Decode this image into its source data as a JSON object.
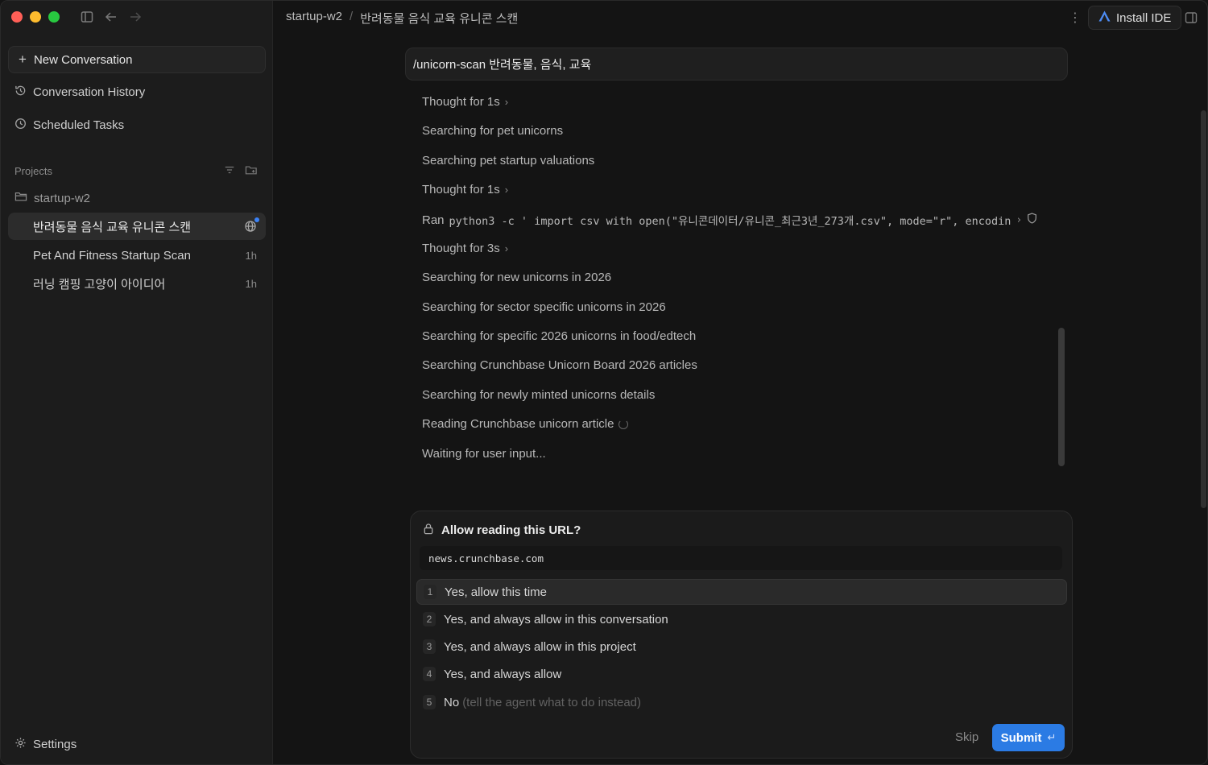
{
  "sidebar": {
    "new_conversation": "New Conversation",
    "conversation_history": "Conversation History",
    "scheduled_tasks": "Scheduled Tasks",
    "projects_label": "Projects",
    "folder": "startup-w2",
    "conversations": [
      {
        "title": "반려동물 음식 교육 유니콘 스캔",
        "time": ""
      },
      {
        "title": "Pet And Fitness Startup Scan",
        "time": "1h"
      },
      {
        "title": "러닝 캠핑 고양이 아이디어",
        "time": "1h"
      }
    ],
    "settings": "Settings"
  },
  "topbar": {
    "project": "startup-w2",
    "separator": "/",
    "conversation": "반려동물 음식 교육 유니콘 스캔",
    "install_ide": "Install IDE"
  },
  "prompt": "/unicorn-scan 반려동물, 음식, 교육",
  "steps": [
    {
      "text": "Thought for 1s"
    },
    {
      "text": "Searching for pet unicorns"
    },
    {
      "text": "Searching pet startup valuations"
    },
    {
      "text": "Thought for 1s"
    },
    {
      "label": "Ran",
      "code": "python3 -c ' import csv with open(\"유니콘데이터/유니콘_최근3년_273개.csv\", mode=\"r\", encodin"
    },
    {
      "text": "Thought for 3s"
    },
    {
      "text": "Searching for new unicorns in 2026"
    },
    {
      "text": "Searching for sector specific unicorns in 2026"
    },
    {
      "text": "Searching for specific 2026 unicorns in food/edtech"
    },
    {
      "text": "Searching Crunchbase Unicorn Board 2026 articles"
    },
    {
      "text": "Searching for newly minted unicorns details"
    },
    {
      "text": "Reading Crunchbase unicorn article"
    },
    {
      "text": "Waiting for user input..."
    }
  ],
  "permission": {
    "title": "Allow reading this URL?",
    "url": "news.crunchbase.com",
    "options": [
      {
        "num": "1",
        "label": "Yes, allow this time",
        "hint": ""
      },
      {
        "num": "2",
        "label": "Yes, and always allow in this conversation",
        "hint": ""
      },
      {
        "num": "3",
        "label": "Yes, and always allow in this project",
        "hint": ""
      },
      {
        "num": "4",
        "label": "Yes, and always allow",
        "hint": ""
      },
      {
        "num": "5",
        "label": "No",
        "hint": "(tell the agent what to do instead)"
      }
    ],
    "skip": "Skip",
    "submit": "Submit",
    "submit_key": "↵"
  },
  "colors": {
    "accent": "#2b7be4",
    "background": "#141414",
    "sidebar": "#1c1c1c"
  }
}
